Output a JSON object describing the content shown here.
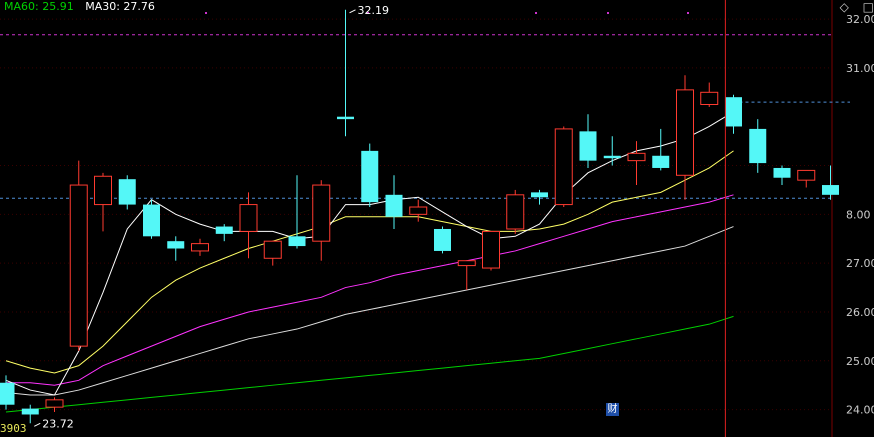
{
  "header": {
    "ma60_label": "MA60: 25.91",
    "ma30_label": "MA30: 27.76",
    "ma60_color": "#00d000",
    "ma30_color": "#ffffff"
  },
  "toolbar": {
    "diamond_icon": "diamond-icon",
    "close_icon": "close-icon",
    "diamond_glyph": "◇",
    "close_glyph": "□"
  },
  "footer": {
    "code_label": "3903",
    "fin_badge": "财"
  },
  "chart_data": {
    "type": "candlestick",
    "ylim": [
      23.5,
      32.35
    ],
    "y_ticks": [
      "32.00",
      "31.00",
      "",
      "8.00",
      "27.00",
      "26.00",
      "25.00",
      "24.00"
    ],
    "y_tick_values": [
      32.0,
      31.0,
      29.0,
      28.0,
      27.0,
      26.0,
      25.0,
      24.0
    ],
    "annotations": [
      {
        "text": "32.19",
        "value": 32.19,
        "candle": 14
      },
      {
        "text": "23.72",
        "value": 23.72,
        "candle": 1
      }
    ],
    "colors": {
      "up": "#ff3b30",
      "down": "#54f7f7",
      "flat": "#ffffff",
      "ma5": "#ffffff",
      "ma10": "#ffff66",
      "ma20": "#ff33ff",
      "ma30": "#dddddd",
      "ma60": "#00d000",
      "dash_purple": "#cc33cc",
      "dash_blue": "#4f8fd8",
      "cursor": "#e02020"
    },
    "candles": [
      {
        "o": 24.55,
        "h": 24.7,
        "c": 24.1,
        "l": 24.0
      },
      {
        "o": 24.02,
        "h": 24.1,
        "c": 23.9,
        "l": 23.72
      },
      {
        "o": 24.05,
        "h": 24.25,
        "c": 24.2,
        "l": 23.95
      },
      {
        "o": 25.3,
        "h": 29.1,
        "c": 28.6,
        "l": 25.2
      },
      {
        "o": 28.2,
        "h": 28.85,
        "c": 28.78,
        "l": 27.65
      },
      {
        "o": 28.72,
        "h": 28.8,
        "c": 28.2,
        "l": 28.1
      },
      {
        "o": 28.2,
        "h": 28.3,
        "c": 27.55,
        "l": 27.5
      },
      {
        "o": 27.45,
        "h": 27.55,
        "c": 27.3,
        "l": 27.05
      },
      {
        "o": 27.25,
        "h": 27.5,
        "c": 27.4,
        "l": 27.15
      },
      {
        "o": 27.75,
        "h": 27.8,
        "c": 27.6,
        "l": 27.45
      },
      {
        "o": 27.65,
        "h": 28.45,
        "c": 28.2,
        "l": 27.1
      },
      {
        "o": 27.1,
        "h": 27.35,
        "c": 27.45,
        "l": 26.95
      },
      {
        "o": 27.55,
        "h": 28.8,
        "c": 27.35,
        "l": 27.3
      },
      {
        "o": 27.45,
        "h": 28.7,
        "c": 28.6,
        "l": 27.05
      },
      {
        "o": 30.0,
        "h": 32.19,
        "c": 29.95,
        "l": 29.6
      },
      {
        "o": 29.3,
        "h": 29.45,
        "c": 28.25,
        "l": 28.15
      },
      {
        "o": 28.4,
        "h": 28.8,
        "c": 27.95,
        "l": 27.7
      },
      {
        "o": 28.0,
        "h": 28.3,
        "c": 28.15,
        "l": 27.85
      },
      {
        "o": 27.7,
        "h": 27.75,
        "c": 27.25,
        "l": 27.2
      },
      {
        "o": 26.95,
        "h": 27.05,
        "c": 27.05,
        "l": 26.45
      },
      {
        "o": 26.9,
        "h": 27.65,
        "c": 27.65,
        "l": 26.85
      },
      {
        "o": 27.7,
        "h": 28.5,
        "c": 28.4,
        "l": 27.6
      },
      {
        "o": 28.45,
        "h": 28.5,
        "c": 28.35,
        "l": 28.2
      },
      {
        "o": 28.2,
        "h": 29.8,
        "c": 29.75,
        "l": 28.15
      },
      {
        "o": 29.7,
        "h": 30.05,
        "c": 29.1,
        "l": 28.95
      },
      {
        "o": 29.2,
        "h": 29.6,
        "c": 29.15,
        "l": 29.0
      },
      {
        "o": 29.1,
        "h": 29.5,
        "c": 29.25,
        "l": 28.6
      },
      {
        "o": 29.2,
        "h": 29.75,
        "c": 28.95,
        "l": 28.9
      },
      {
        "o": 28.8,
        "h": 30.85,
        "c": 30.55,
        "l": 28.3
      },
      {
        "o": 30.25,
        "h": 30.7,
        "c": 30.5,
        "l": 30.2
      },
      {
        "o": 30.4,
        "h": 30.45,
        "c": 29.8,
        "l": 29.65
      },
      {
        "o": 29.75,
        "h": 29.95,
        "c": 29.05,
        "l": 28.85
      },
      {
        "o": 28.95,
        "h": 29.0,
        "c": 28.75,
        "l": 28.6
      },
      {
        "o": 28.7,
        "h": 28.85,
        "c": 28.9,
        "l": 28.55
      },
      {
        "o": 28.6,
        "h": 29.0,
        "c": 28.4,
        "l": 28.3
      }
    ],
    "ma5": [
      24.6,
      24.4,
      24.3,
      25.2,
      26.4,
      27.7,
      28.3,
      28.0,
      27.8,
      27.65,
      27.65,
      27.65,
      27.5,
      27.55,
      28.2,
      28.2,
      28.3,
      28.35,
      28.05,
      27.75,
      27.5,
      27.55,
      27.8,
      28.4,
      28.85,
      29.1,
      29.3,
      29.4,
      29.55,
      29.8,
      30.1
    ],
    "ma10": [
      25.0,
      24.85,
      24.75,
      24.9,
      25.3,
      25.8,
      26.3,
      26.65,
      26.9,
      27.1,
      27.3,
      27.45,
      27.6,
      27.75,
      27.95,
      27.95,
      27.95,
      27.95,
      27.85,
      27.75,
      27.65,
      27.65,
      27.7,
      27.8,
      28.0,
      28.25,
      28.35,
      28.45,
      28.7,
      28.95,
      29.3
    ],
    "ma20": [
      24.55,
      24.55,
      24.5,
      24.6,
      24.9,
      25.1,
      25.3,
      25.5,
      25.7,
      25.85,
      26.0,
      26.1,
      26.2,
      26.3,
      26.5,
      26.6,
      26.75,
      26.85,
      26.95,
      27.05,
      27.15,
      27.25,
      27.4,
      27.55,
      27.7,
      27.85,
      27.95,
      28.05,
      28.15,
      28.25,
      28.4
    ],
    "ma30": [
      24.35,
      24.3,
      24.3,
      24.4,
      24.55,
      24.7,
      24.85,
      25.0,
      25.15,
      25.3,
      25.45,
      25.55,
      25.65,
      25.8,
      25.95,
      26.05,
      26.15,
      26.25,
      26.35,
      26.45,
      26.55,
      26.65,
      26.75,
      26.85,
      26.95,
      27.05,
      27.15,
      27.25,
      27.35,
      27.55,
      27.75
    ],
    "ma60": [
      23.95,
      24.0,
      24.05,
      24.1,
      24.15,
      24.2,
      24.25,
      24.3,
      24.35,
      24.4,
      24.45,
      24.5,
      24.55,
      24.6,
      24.65,
      24.7,
      24.75,
      24.8,
      24.85,
      24.9,
      24.95,
      25.0,
      25.05,
      25.15,
      25.25,
      25.35,
      25.45,
      25.55,
      25.65,
      25.75,
      25.91
    ],
    "ref_lines": [
      {
        "value": 31.68,
        "style": "dash_purple",
        "span": "full"
      },
      {
        "value": 28.33,
        "style": "dash_blue",
        "span": "full"
      },
      {
        "value": 30.3,
        "style": "dash_blue",
        "span": "right"
      }
    ],
    "cursor_candle": 29.5
  }
}
